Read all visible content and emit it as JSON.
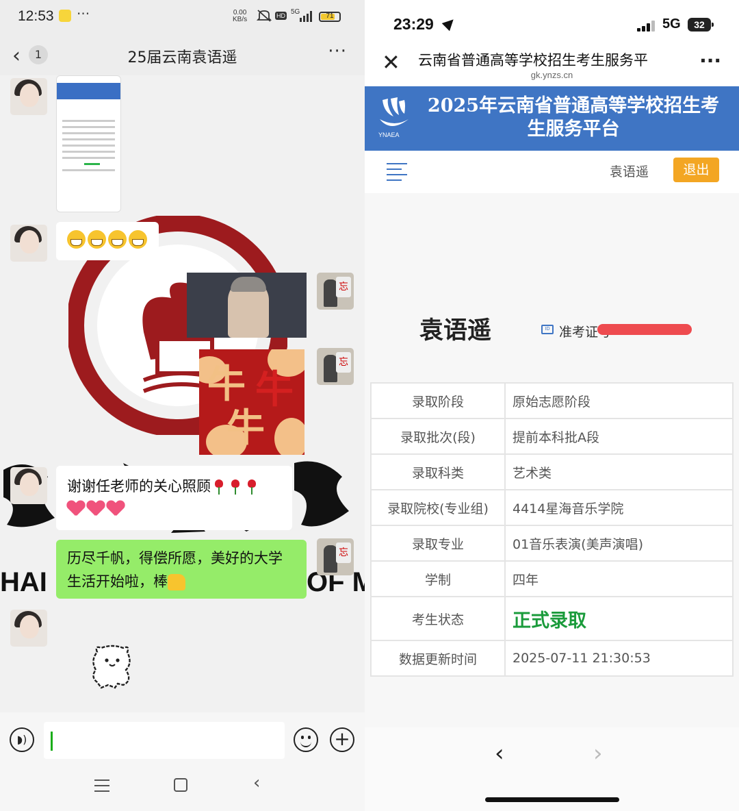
{
  "left_phone": {
    "status": {
      "time": "12:53",
      "net_speed_value": "0.00",
      "net_speed_unit": "KB/s",
      "hd": "HD",
      "net": "5G",
      "battery": "71",
      "colors": {
        "battery_fill": "#f2c72f",
        "app_icon": "#f7d53b"
      }
    },
    "nav": {
      "back_icon": "chevron-left-icon",
      "unread_count": "1",
      "title": "25届云南袁语遥",
      "more_icon": "more-dots-icon"
    },
    "messages": {
      "thanks_text": "谢谢任老师的关心照顾",
      "reply_text_line1": "历尽千帆，得偿所愿，美好的大学",
      "reply_text_line2": "生活开始啦，棒"
    },
    "sticker_niu": "牛",
    "logo_text": "XINGHAI CONSERVA",
    "bg_text_left": "HAI",
    "bg_text_right": "OF M",
    "colors": {
      "reply_bubble": "#95ec69",
      "chat_bg": "#f1f1f1"
    }
  },
  "right_phone": {
    "status": {
      "time": "23:29",
      "net": "5G",
      "battery": "32"
    },
    "browser": {
      "page_title": "云南省普通高等学校招生考生服务平",
      "domain": "gk.ynzs.cn",
      "close_icon": "close-icon",
      "more_icon": "more-dots-icon"
    },
    "header": {
      "title": "2025年云南省普通高等学校招生考生服务平台",
      "logo_text": "YNAEA",
      "color": "#3f75c4"
    },
    "toolbar": {
      "user": "袁语遥",
      "logout": "退出",
      "logout_color": "#f3a623"
    },
    "profile": {
      "name": "袁语遥",
      "id_label": "准考证号"
    },
    "table": [
      {
        "key": "录取阶段",
        "value": "原始志愿阶段"
      },
      {
        "key": "录取批次(段)",
        "value": "提前本科批A段"
      },
      {
        "key": "录取科类",
        "value": "艺术类"
      },
      {
        "key": "录取院校(专业组)",
        "value": "4414星海音乐学院"
      },
      {
        "key": "录取专业",
        "value": "01音乐表演(美声演唱)"
      },
      {
        "key": "学制",
        "value": "四年"
      },
      {
        "key": "考生状态",
        "value": "正式录取"
      },
      {
        "key": "数据更新时间",
        "value": "2025-07-11 21:30:53"
      }
    ],
    "colors": {
      "status_ok": "#1a9b3b"
    }
  }
}
